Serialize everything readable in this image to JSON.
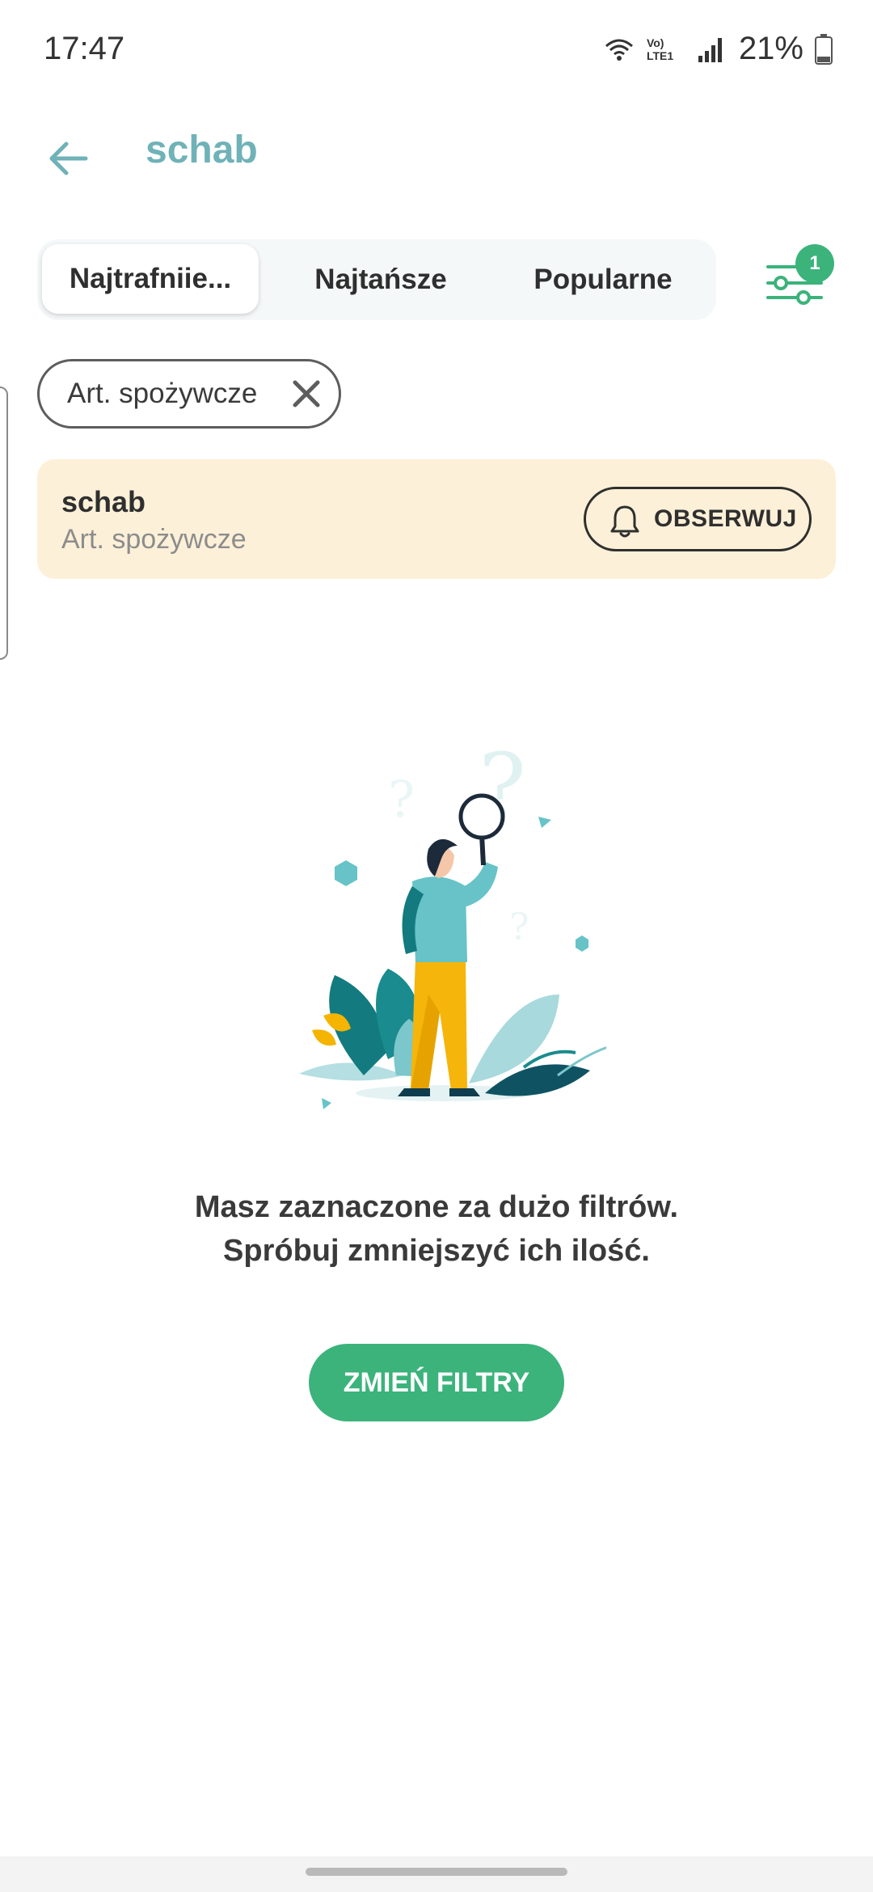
{
  "status_bar": {
    "time": "17:47",
    "network": "Vo) LTE1",
    "battery_percent": "21%",
    "icons": [
      "wifi-icon",
      "volte-icon",
      "signal-icon",
      "battery-icon"
    ]
  },
  "header": {
    "title": "schab",
    "back_icon": "arrow-left-icon"
  },
  "sort_tabs": {
    "items": [
      {
        "label": "Najtrafniie...",
        "active": true
      },
      {
        "label": "Najtańsze",
        "active": false
      },
      {
        "label": "Popularne",
        "active": false
      }
    ]
  },
  "filter_button": {
    "icon": "sliders-icon",
    "badge": "1"
  },
  "active_filter_chip": {
    "label": "Art. spożywcze",
    "close_icon": "close-icon"
  },
  "alert_card": {
    "title": "schab",
    "subtitle": "Art. spożywcze",
    "button_label": "OBSERWUJ",
    "button_icon": "bell-icon"
  },
  "empty_state": {
    "line1": "Masz zaznaczone za dużo filtrów.",
    "line2": "Spróbuj zmniejszyć ich ilość.",
    "button_label": "ZMIEŃ FILTRY"
  },
  "colors": {
    "accent": "#3bb37b",
    "title_teal": "#6fb2b8",
    "card_bg": "#fdf0d8"
  }
}
